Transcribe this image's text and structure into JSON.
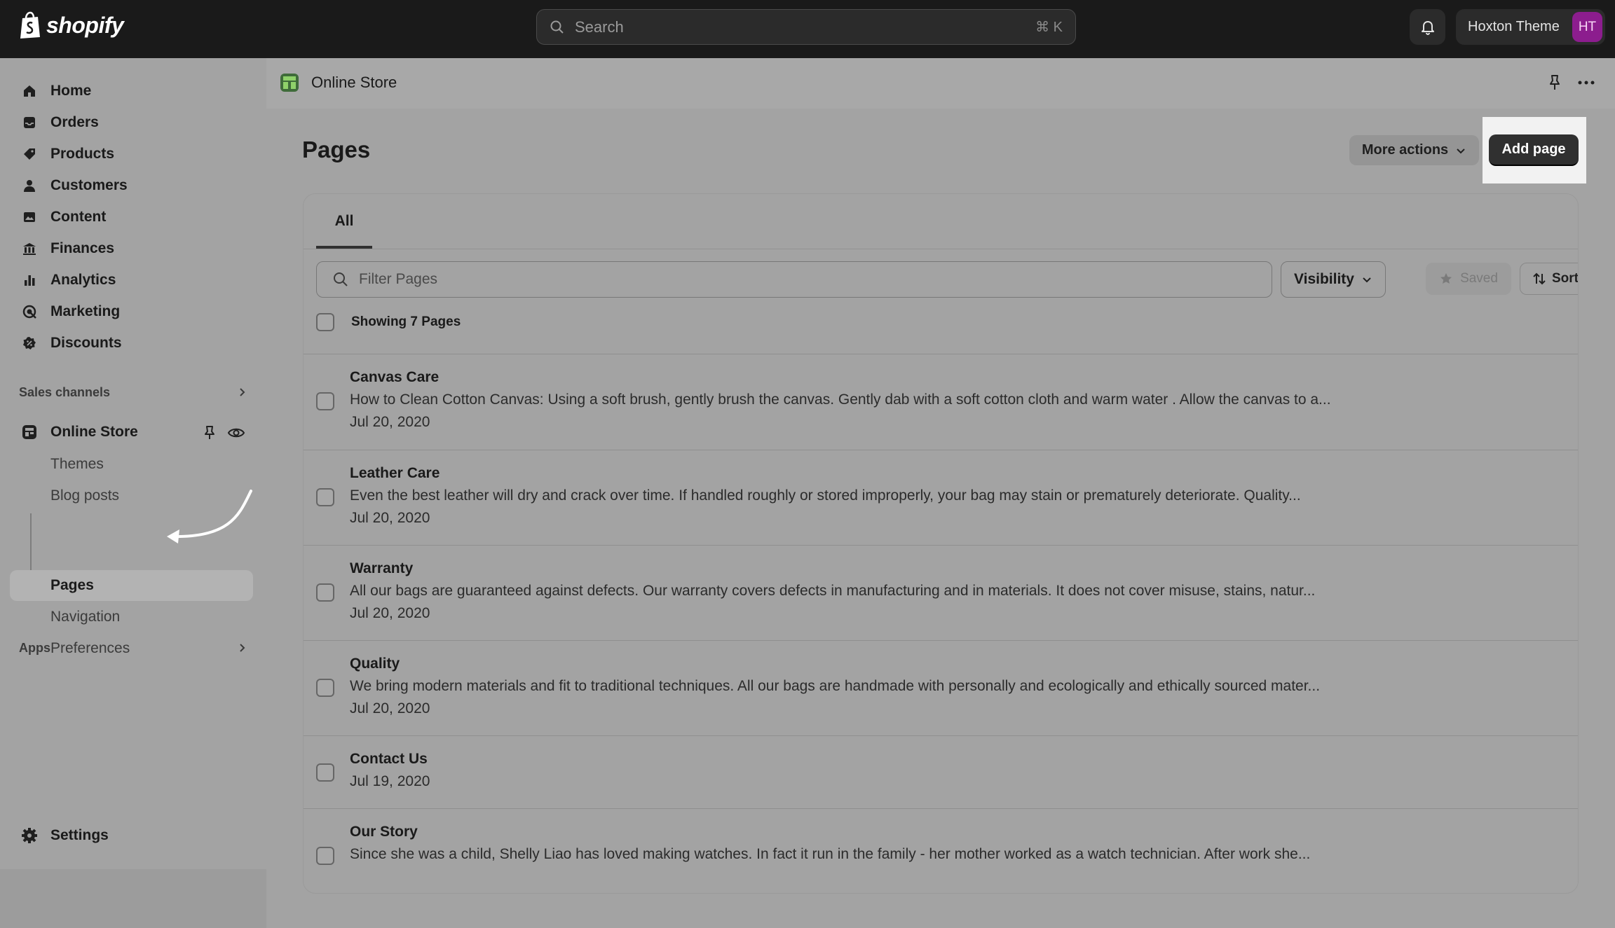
{
  "topbar": {
    "logo_text": "shopify",
    "search_placeholder": "Search",
    "search_shortcut": "⌘ K",
    "store_name": "Hoxton Theme",
    "avatar_initials": "HT"
  },
  "sidebar": {
    "items": [
      {
        "label": "Home",
        "icon": "home-icon"
      },
      {
        "label": "Orders",
        "icon": "inbox-icon"
      },
      {
        "label": "Products",
        "icon": "tag-icon"
      },
      {
        "label": "Customers",
        "icon": "person-icon"
      },
      {
        "label": "Content",
        "icon": "image-icon"
      },
      {
        "label": "Finances",
        "icon": "bank-icon"
      },
      {
        "label": "Analytics",
        "icon": "bar-chart-icon"
      },
      {
        "label": "Marketing",
        "icon": "target-icon"
      },
      {
        "label": "Discounts",
        "icon": "discount-icon"
      }
    ],
    "sales_channels_label": "Sales channels",
    "online_store_label": "Online Store",
    "online_store_sub": [
      "Themes",
      "Blog posts",
      "Pages",
      "Navigation",
      "Preferences"
    ],
    "apps_label": "Apps",
    "settings_label": "Settings"
  },
  "main": {
    "breadcrumb": "Online Store",
    "page_title": "Pages",
    "more_actions_label": "More actions",
    "add_page_label": "Add page",
    "tab_all": "All",
    "filter_placeholder": "Filter Pages",
    "visibility_label": "Visibility",
    "saved_label": "Saved",
    "sort_label": "Sort",
    "showing_label": "Showing 7 Pages",
    "rows": [
      {
        "title": "Canvas Care",
        "desc": "How to Clean Cotton Canvas: Using a soft brush, gently brush the canvas. Gently dab with a soft cotton cloth and warm water . Allow the canvas to a...",
        "date": "Jul 20, 2020"
      },
      {
        "title": "Leather Care",
        "desc": "Even the best leather will dry and crack over time. If handled roughly or stored improperly, your bag may stain or prematurely deteriorate. Quality...",
        "date": "Jul 20, 2020"
      },
      {
        "title": "Warranty",
        "desc": "All our bags are guaranteed against defects. Our warranty covers defects in manufacturing and in materials. It does not cover misuse, stains, natur...",
        "date": "Jul 20, 2020"
      },
      {
        "title": "Quality",
        "desc": "We bring modern materials and fit to traditional techniques. All our bags are handmade with personally and ecologically and ethically sourced mater...",
        "date": "Jul 20, 2020"
      },
      {
        "title": "Contact Us",
        "desc": "",
        "date": "Jul 19, 2020"
      },
      {
        "title": "Our Story",
        "desc": "Since she was a child, Shelly Liao has loved making watches. In fact it run in the family - her mother worked as a watch technician. After work she...",
        "date": ""
      }
    ]
  },
  "colors": {
    "topbar_bg": "#1a1a1a",
    "add_button_bg": "#303030",
    "avatar_bg": "#8c1d8e"
  }
}
